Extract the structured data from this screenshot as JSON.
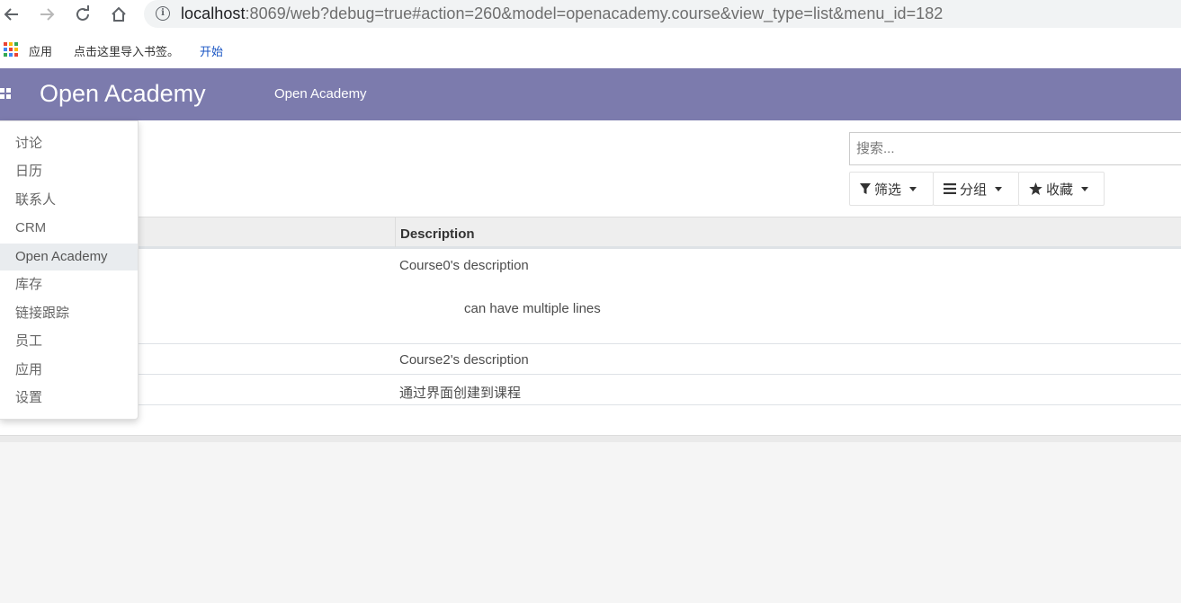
{
  "browser": {
    "url_host": "localhost",
    "url_rest": ":8069/web?debug=true#action=260&model=openacademy.course&view_type=list&menu_id=182",
    "bookmarks": {
      "apps_label": "应用",
      "import_label": "点击这里导入书签。",
      "start_label": "开始"
    }
  },
  "navbar": {
    "brand": "Open Academy",
    "menu_item": "Open Academy",
    "bg_color": "#7c7bad"
  },
  "search": {
    "placeholder": "搜索..."
  },
  "control_panel": {
    "filter_label": "筛选",
    "group_label": "分组",
    "favorites_label": "收藏"
  },
  "table": {
    "columns": [
      "Description"
    ],
    "rows": [
      {
        "line1": "Course0's description",
        "line2": "can have multiple lines"
      },
      {
        "line1": "Course2's description"
      },
      {
        "line1": "通过界面创建到课程"
      }
    ]
  },
  "apps_menu": {
    "items": [
      "讨论",
      "日历",
      "联系人",
      "CRM",
      "Open Academy",
      "库存",
      "链接跟踪",
      "员工",
      "应用",
      "设置"
    ],
    "active": "Open Academy"
  }
}
